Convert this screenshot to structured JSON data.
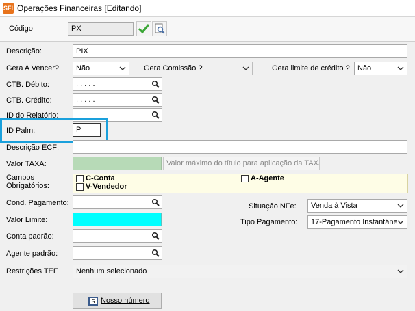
{
  "window": {
    "title": "Operações Financeiras [Editando]",
    "logo": "SFI"
  },
  "codigo": {
    "label": "Código",
    "value": "PX"
  },
  "fields": {
    "descricao": {
      "label": "Descrição:",
      "value": "PIX"
    },
    "gera_vencer": {
      "label": "Gera A Vencer?",
      "value": "Não"
    },
    "gera_comissao": {
      "label": "Gera Comissão ?",
      "value": ""
    },
    "gera_limite": {
      "label": "Gera limite de crédito ?",
      "value": "Não"
    },
    "ctb_debito": {
      "label": "CTB. Débito:",
      "value": ". . . . ."
    },
    "ctb_credito": {
      "label": "CTB. Crédito:",
      "value": ". . . . ."
    },
    "id_relatorio": {
      "label": "ID do Relatório:",
      "value": ""
    },
    "id_palm": {
      "label": "ID Palm:",
      "value": "P"
    },
    "descricao_ecf": {
      "label": "Descrição ECF:",
      "value": ""
    },
    "valor_taxa": {
      "label": "Valor TAXA:",
      "value": ""
    },
    "valor_maximo": {
      "label": "Valor máximo do título para aplicação da TAXA:",
      "value": ""
    },
    "campos_obrigatorios": {
      "label_line1": "Campos",
      "label_line2": "Obrigatórios:",
      "options": [
        "C-Conta",
        "V-Vendedor",
        "A-Agente"
      ]
    },
    "cond_pagamento": {
      "label": "Cond. Pagamento:",
      "value": ""
    },
    "valor_limite": {
      "label": "Valor Limite:",
      "value": ""
    },
    "conta_padrao": {
      "label": "Conta padrão:",
      "value": ""
    },
    "agente_padrao": {
      "label": "Agente padrão:",
      "value": ""
    },
    "situacao_nfe": {
      "label": "Situação NFe:",
      "value": "Venda à Vista"
    },
    "tipo_pagamento": {
      "label": "Tipo Pagamento:",
      "value": "17-Pagamento Instantâne"
    },
    "restricoes_tef": {
      "label": "Restrições TEF",
      "value": "Nenhum selecionado"
    }
  },
  "buttons": {
    "nosso_numero": "Nosso número"
  },
  "colors": {
    "highlight": "#1aa0dc",
    "valor_limite_bg": "#00ffff",
    "valor_taxa_bg": "#b7dab7",
    "confirm": "#3aa635"
  }
}
